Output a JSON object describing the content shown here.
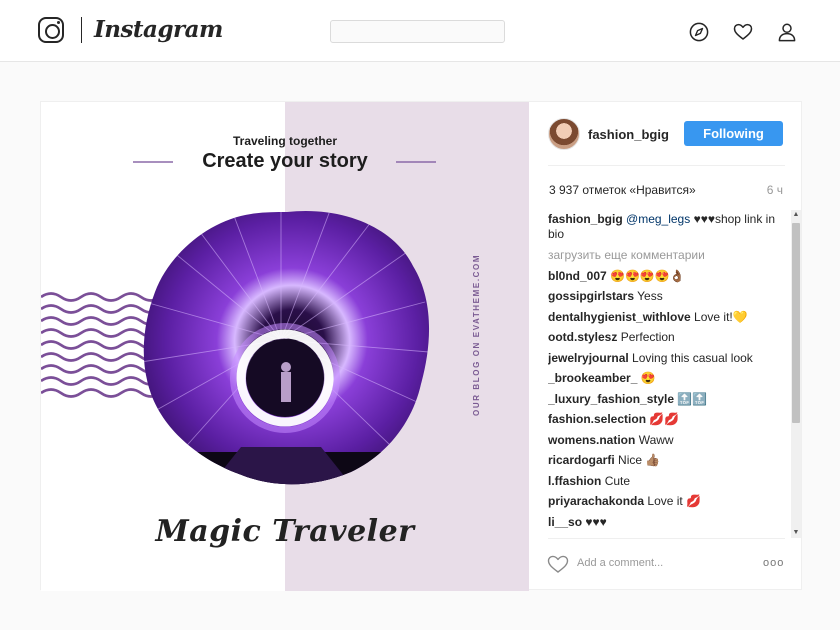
{
  "header": {
    "logo_text": "Instagram",
    "search_value": "",
    "icons": [
      "instagram-camera-icon",
      "compass-icon",
      "heart-icon",
      "profile-icon"
    ]
  },
  "post": {
    "image": {
      "subtitle": "Traveling together",
      "headline": "Create your story",
      "signature": "Magic Traveler",
      "vertical_text": "OUR BLOG ON EVATHEME.COM",
      "colors": {
        "accent": "#7b4f98",
        "panel": "#e8dde8",
        "glow": "#a855f7"
      }
    },
    "owner": "fashion_bgig",
    "follow_label": "Following",
    "likes": "3 937 отметок «Нравится»",
    "time": "6 ч",
    "caption": {
      "user": "fashion_bgig",
      "mention": "@meg_legs",
      "text": "♥♥♥shop link in bio"
    },
    "load_more": "загрузить еще комментарии",
    "comments": [
      {
        "user": "bl0nd_007",
        "text": "😍😍😍😍👌🏾"
      },
      {
        "user": "gossipgirlstars",
        "text": "Yess"
      },
      {
        "user": "dentalhygienist_withlove",
        "text": "Love it!💛"
      },
      {
        "user": "ootd.stylesz",
        "text": "Perfection"
      },
      {
        "user": "jewelryjournal",
        "text": "Loving this casual look"
      },
      {
        "user": "_brookeamber_",
        "text": "😍"
      },
      {
        "user": "_luxury_fashion_style",
        "text": "🔝🔝"
      },
      {
        "user": "fashion.selection",
        "text": "💋💋"
      },
      {
        "user": "womens.nation",
        "text": "Waww"
      },
      {
        "user": "ricardogarfi",
        "text": "Nice 👍🏽"
      },
      {
        "user": "l.ffashion",
        "text": "Cute"
      },
      {
        "user": "priyarachakonda",
        "text": "Love it 💋"
      },
      {
        "user": "li__so",
        "text": "♥♥♥"
      }
    ],
    "add_comment_placeholder": "Add a comment...",
    "more_label": "ооо",
    "colors": {
      "follow_button": "#3897f0"
    }
  }
}
